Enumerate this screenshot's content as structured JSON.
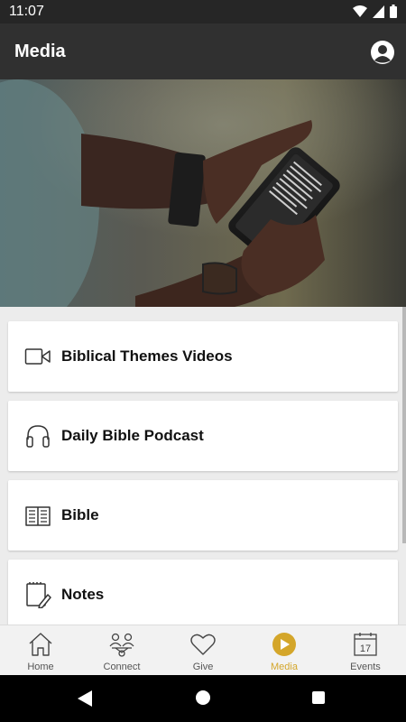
{
  "status_bar": {
    "time": "11:07"
  },
  "app_bar": {
    "title": "Media"
  },
  "menu": {
    "items": [
      {
        "label": "Biblical Themes Videos",
        "icon": "video-camera-icon"
      },
      {
        "label": "Daily Bible Podcast",
        "icon": "headphones-icon"
      },
      {
        "label": "Bible",
        "icon": "open-book-icon"
      },
      {
        "label": "Notes",
        "icon": "notepad-pencil-icon"
      }
    ]
  },
  "bottom_nav": {
    "items": [
      {
        "label": "Home",
        "icon": "house-icon"
      },
      {
        "label": "Connect",
        "icon": "people-icon"
      },
      {
        "label": "Give",
        "icon": "heart-icon"
      },
      {
        "label": "Media",
        "icon": "play-icon",
        "active": true
      },
      {
        "label": "Events",
        "icon": "calendar-icon",
        "day": "17"
      }
    ]
  },
  "colors": {
    "accent": "#d4a62a",
    "app_bar": "#303030",
    "status_bar": "#262626"
  }
}
